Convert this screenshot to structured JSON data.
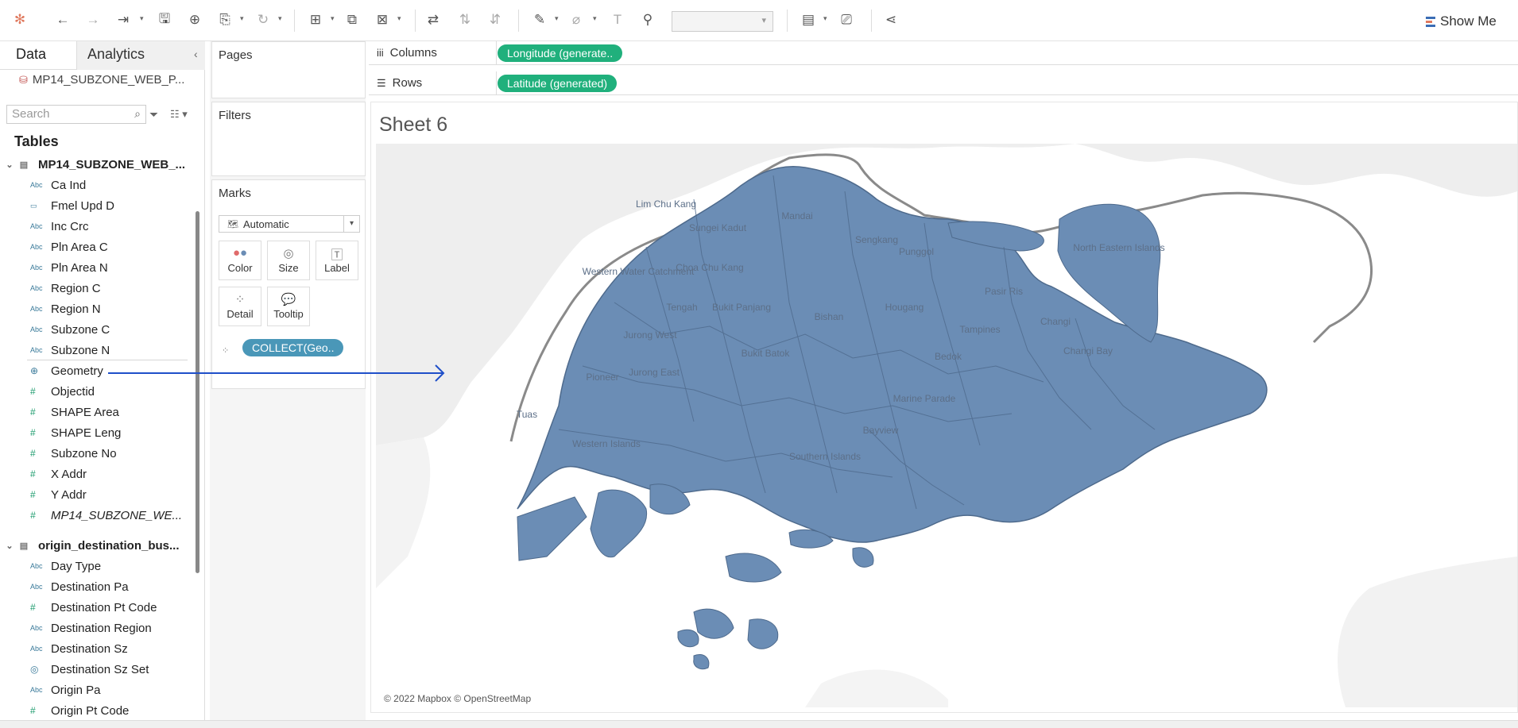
{
  "toolbar": {
    "show_me_label": "Show Me",
    "icons": [
      "tableau-logo-icon",
      "undo-icon",
      "redo-icon",
      "replay-icon",
      "save-icon",
      "new-datasource-icon",
      "pause-icon",
      "refresh-icon",
      "new-sheet-icon",
      "duplicate-icon",
      "clear-icon",
      "swap-icon",
      "sort-asc-icon",
      "sort-desc-icon",
      "highlight-icon",
      "group-icon",
      "label-icon",
      "pin-icon",
      "fit-icon",
      "presentation-icon",
      "share-icon"
    ]
  },
  "side_panel": {
    "tab_data": "Data",
    "tab_analytics": "Analytics",
    "datasource_name": "MP14_SUBZONE_WEB_P...",
    "search_placeholder": "Search",
    "tables_heading": "Tables",
    "groups": [
      {
        "name": "MP14_SUBZONE_WEB_...",
        "fields": [
          {
            "type": "Abc",
            "label": "Ca Ind"
          },
          {
            "type": "date",
            "label": "Fmel Upd D"
          },
          {
            "type": "Abc",
            "label": "Inc Crc"
          },
          {
            "type": "Abc",
            "label": "Pln Area C"
          },
          {
            "type": "Abc",
            "label": "Pln Area N"
          },
          {
            "type": "Abc",
            "label": "Region C"
          },
          {
            "type": "Abc",
            "label": "Region N"
          },
          {
            "type": "Abc",
            "label": "Subzone C"
          },
          {
            "type": "Abc",
            "label": "Subzone N"
          },
          {
            "type": "geo",
            "label": "Geometry"
          },
          {
            "type": "#",
            "label": "Objectid"
          },
          {
            "type": "#",
            "label": "SHAPE Area"
          },
          {
            "type": "#",
            "label": "SHAPE Leng"
          },
          {
            "type": "#",
            "label": "Subzone No"
          },
          {
            "type": "#",
            "label": "X Addr"
          },
          {
            "type": "#",
            "label": "Y Addr"
          },
          {
            "type": "#",
            "label": "MP14_SUBZONE_WE..."
          }
        ]
      },
      {
        "name": "origin_destination_bus...",
        "fields": [
          {
            "type": "Abc",
            "label": "Day Type"
          },
          {
            "type": "Abc",
            "label": "Destination Pa"
          },
          {
            "type": "#",
            "label": "Destination Pt Code"
          },
          {
            "type": "Abc",
            "label": "Destination Region"
          },
          {
            "type": "Abc",
            "label": "Destination Sz"
          },
          {
            "type": "set",
            "label": "Destination Sz Set"
          },
          {
            "type": "Abc",
            "label": "Origin Pa"
          },
          {
            "type": "#",
            "label": "Origin Pt Code"
          }
        ]
      }
    ]
  },
  "cards": {
    "pages": "Pages",
    "filters": "Filters",
    "marks": "Marks",
    "mark_type": "Automatic",
    "buttons": {
      "color": "Color",
      "size": "Size",
      "label": "Label",
      "detail": "Detail",
      "tooltip": "Tooltip"
    },
    "detail_pill": "COLLECT(Geo.."
  },
  "shelves": {
    "columns_label": "Columns",
    "columns_pill": "Longitude (generate..",
    "rows_label": "Rows",
    "rows_pill": "Latitude (generated)"
  },
  "view": {
    "sheet_title": "Sheet 6",
    "attribution": "© 2022 Mapbox © OpenStreetMap",
    "map_fill_color": "#6b8db5",
    "place_labels": [
      "Lim Chu Kang",
      "Sungei Kadut",
      "Mandai",
      "Western Water Catchment",
      "Choa Chu Kang",
      "Tengah",
      "Bukit Panjang",
      "Jurong West",
      "Bukit Batok",
      "Bishan",
      "Sengkang",
      "Punggol",
      "Pasir Ris",
      "Hougang",
      "Tampines",
      "Bedok",
      "Changi",
      "Changi Bay",
      "North Eastern Islands",
      "Tuas",
      "Pioneer",
      "Jurong East",
      "Western Islands",
      "Southern Islands",
      "Marine Parade",
      "Bayview"
    ]
  }
}
